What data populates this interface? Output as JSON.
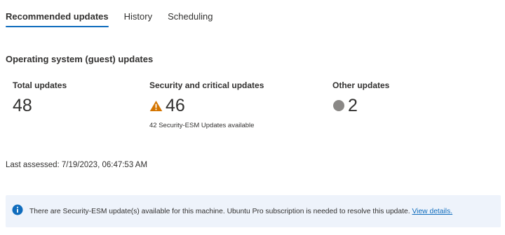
{
  "tabs": [
    {
      "label": "Recommended updates",
      "active": true
    },
    {
      "label": "History",
      "active": false
    },
    {
      "label": "Scheduling",
      "active": false
    }
  ],
  "section": {
    "title": "Operating system (guest) updates"
  },
  "metrics": {
    "total": {
      "title": "Total updates",
      "value": "48"
    },
    "security": {
      "title": "Security and critical updates",
      "value": "46",
      "icon": "warning-triangle-icon",
      "icon_color": "#d47500",
      "subtext": "42 Security-ESM Updates available"
    },
    "other": {
      "title": "Other updates",
      "value": "2",
      "icon": "gray-dot-icon",
      "icon_color": "#8a8886"
    }
  },
  "last_assessed": "Last assessed: 7/19/2023, 06:47:53 AM",
  "banner": {
    "icon": "info-icon",
    "icon_color": "#0f6cbd",
    "text": "There are Security-ESM update(s) available for this machine. Ubuntu Pro subscription is needed to resolve this update.",
    "link_label": "View details."
  }
}
